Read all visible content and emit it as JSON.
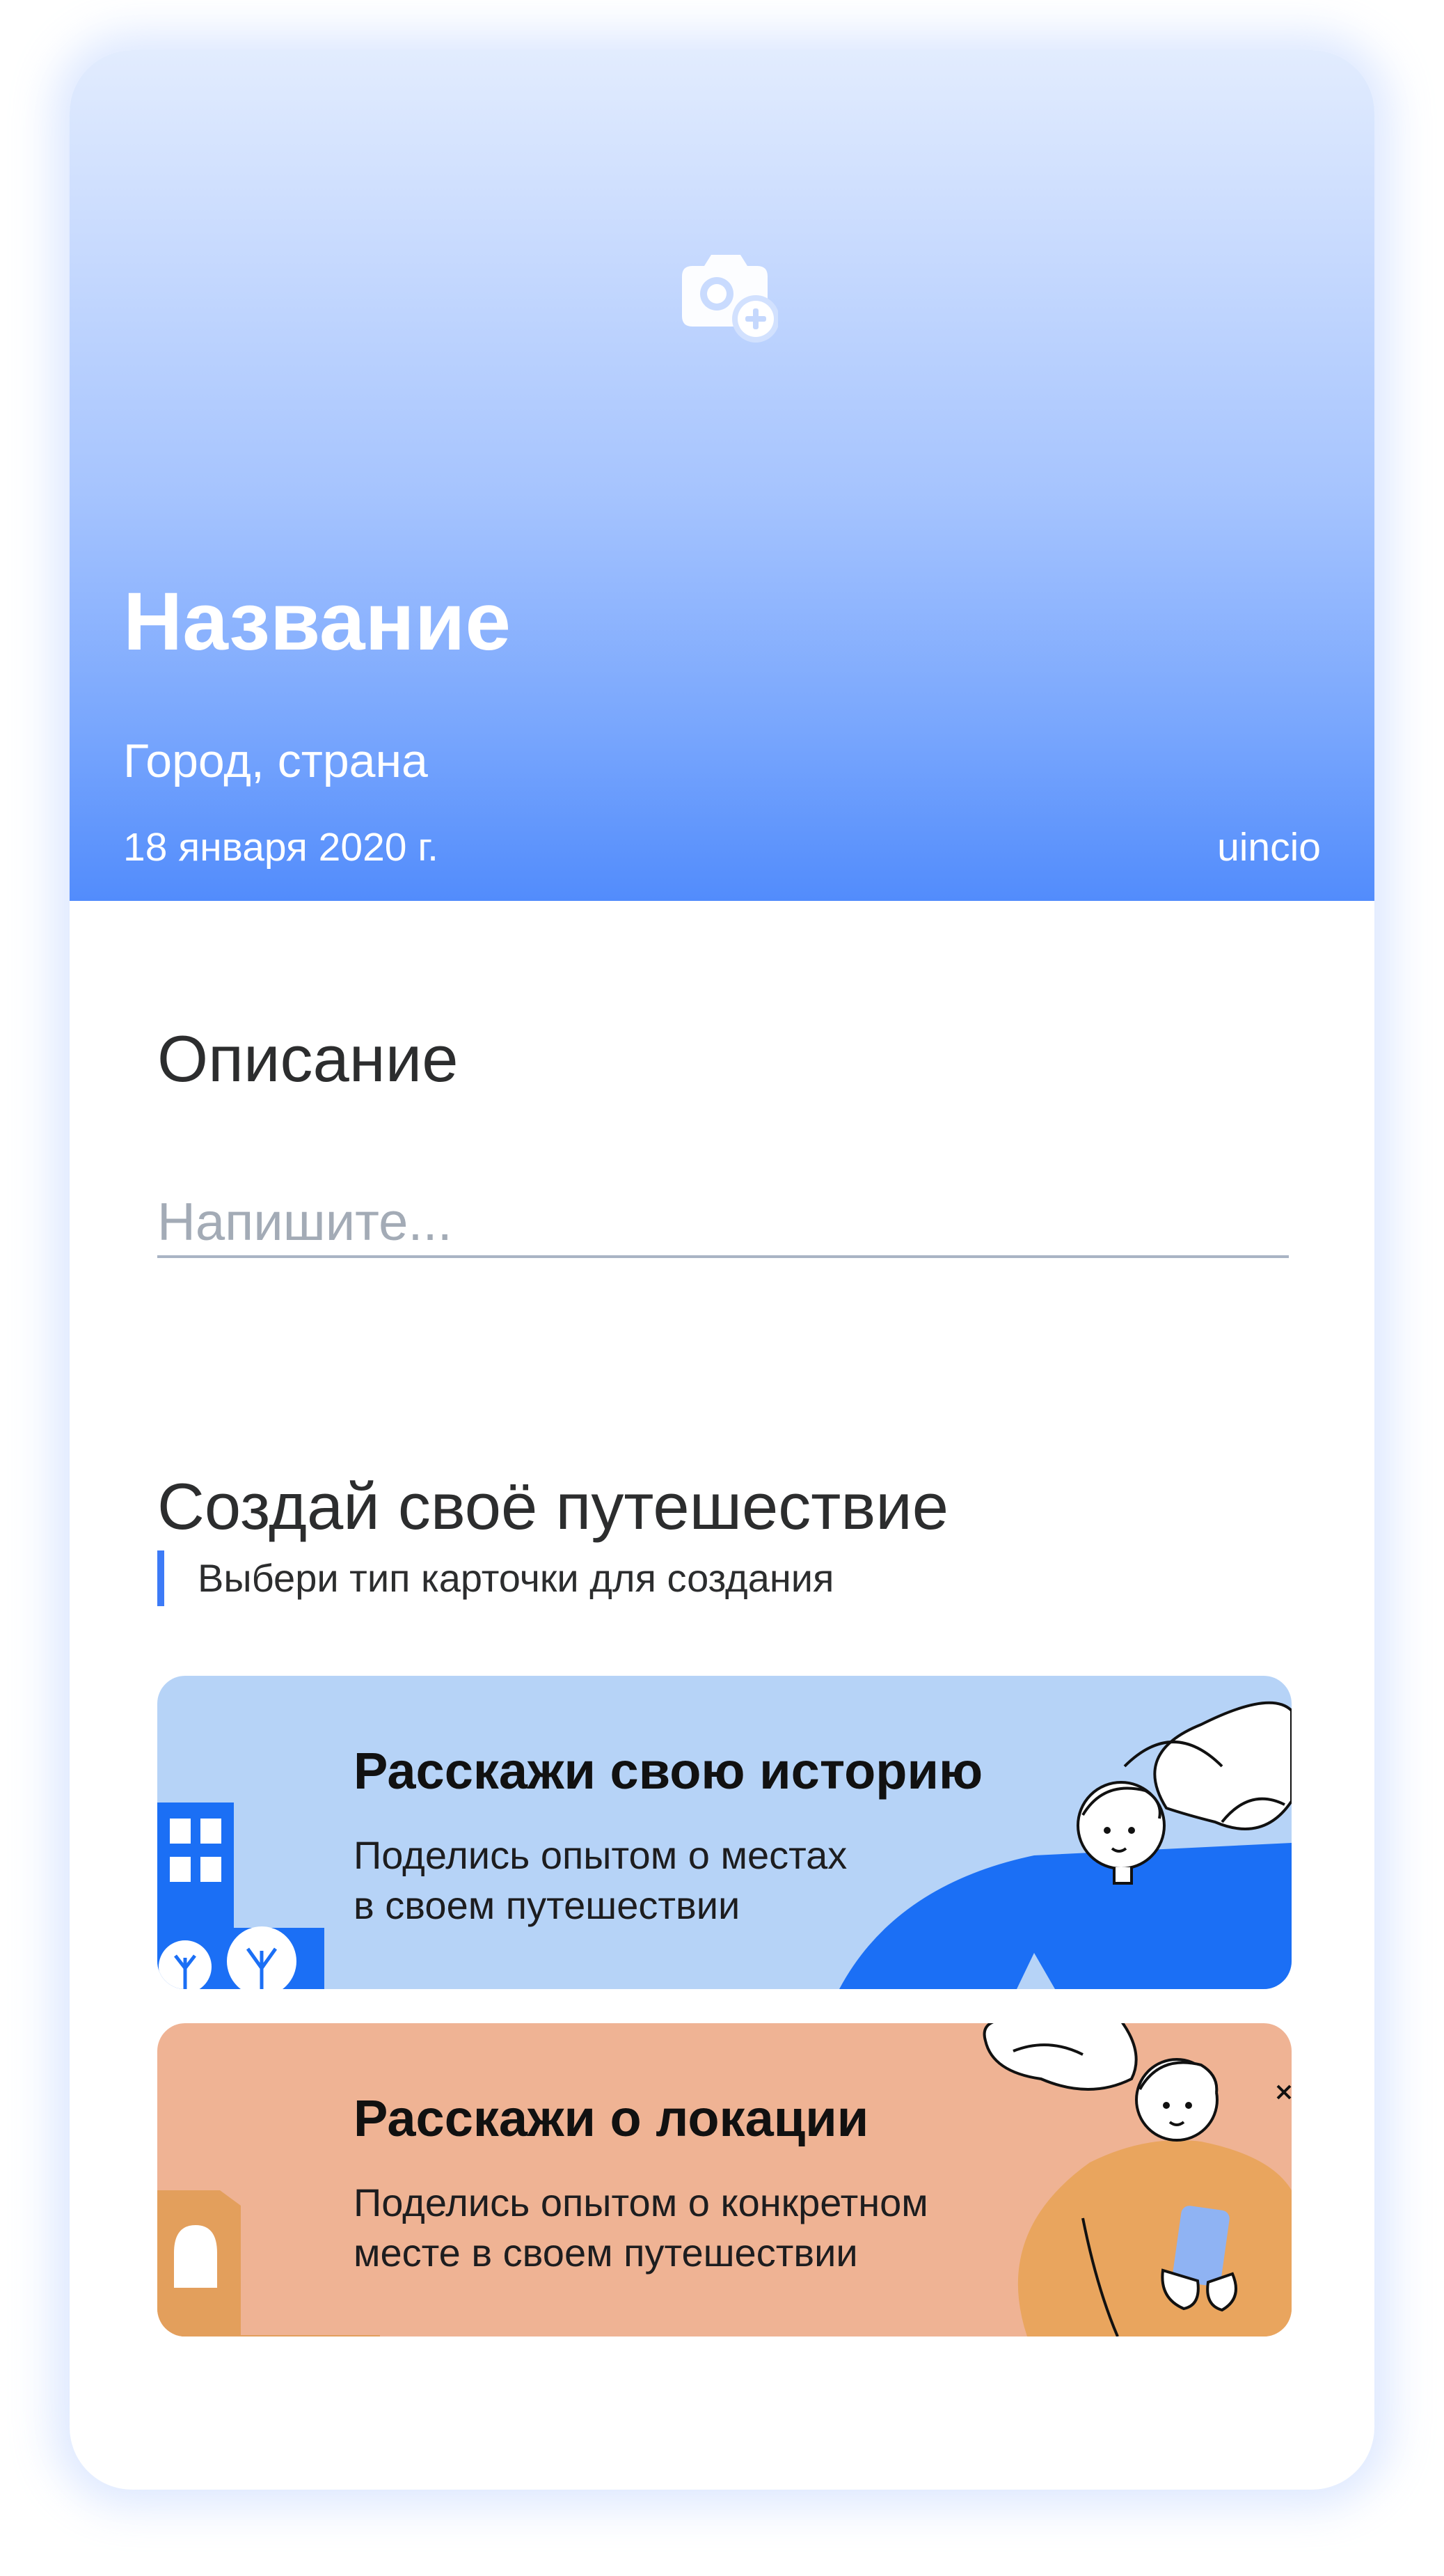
{
  "header": {
    "title": "Название",
    "location": "Город, страна",
    "date": "18 января 2020 г.",
    "author": "uincio",
    "camera_icon": "camera-add-icon"
  },
  "description": {
    "title": "Описание",
    "placeholder": "Напишите..."
  },
  "journey": {
    "title": "Создай своё путешествие",
    "hint": "Выбери тип карточки для создания",
    "cards": [
      {
        "title": "Расскажи свою историю",
        "line1": "Поделись опытом о местах",
        "line2": "в своем путешествии",
        "color": "#b6d3f7"
      },
      {
        "title": "Расскажи о локации",
        "line1": "Поделись опытом о конкретном",
        "line2": "месте в своем путешествии",
        "color": "#efb394"
      }
    ]
  },
  "colors": {
    "accent": "#3d7bf7",
    "header_top": "#e2ecfe",
    "header_bottom": "#528cfc"
  }
}
